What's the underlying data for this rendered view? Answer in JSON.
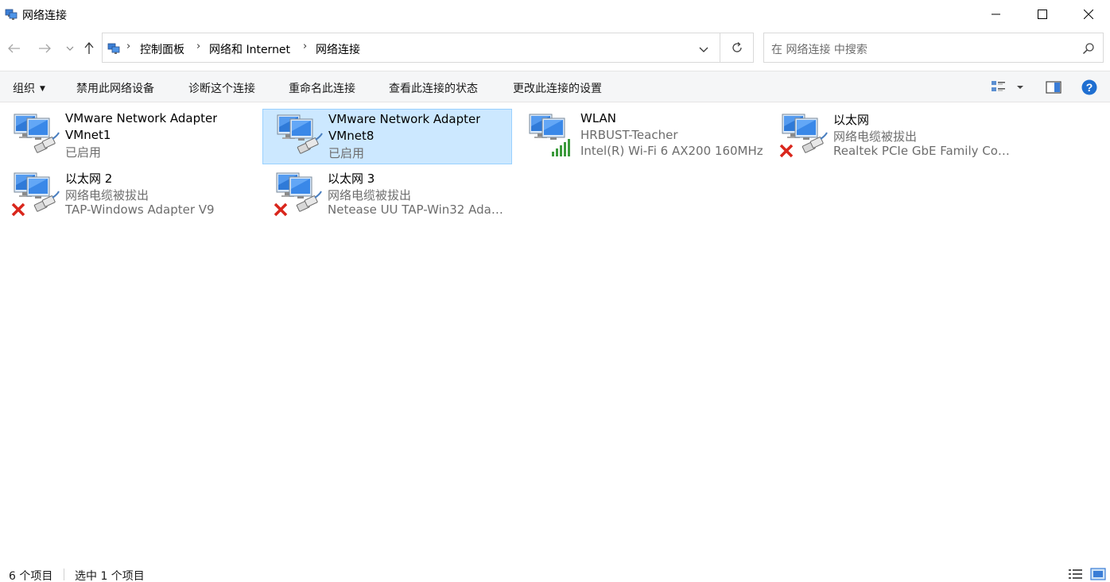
{
  "window": {
    "title": "网络连接",
    "controls": [
      "minimize-icon",
      "maximize-icon",
      "close-icon"
    ]
  },
  "nav": {
    "back_icon": "arrow-left-icon",
    "forward_icon": "arrow-right-icon",
    "recent_icon": "chevron-down-icon",
    "up_icon": "arrow-up-icon"
  },
  "address": {
    "breadcrumbs": [
      "控制面板",
      "网络和 Internet",
      "网络连接"
    ],
    "search_placeholder": "在 网络连接 中搜索"
  },
  "toolbar": {
    "organize_label": "组织",
    "commands": [
      "禁用此网络设备",
      "诊断这个连接",
      "重命名此连接",
      "查看此连接的状态",
      "更改此连接的设置"
    ]
  },
  "connections": [
    {
      "name": "VMware Network Adapter",
      "name2": "VMnet1",
      "status": "已启用",
      "device": "",
      "state": "enabled",
      "selected": false
    },
    {
      "name": "VMware Network Adapter",
      "name2": "VMnet8",
      "status": "已启用",
      "device": "",
      "state": "enabled",
      "selected": true
    },
    {
      "name": "WLAN",
      "name2": "",
      "status": "HRBUST-Teacher",
      "device": "Intel(R) Wi-Fi 6 AX200 160MHz",
      "state": "wifi",
      "selected": false
    },
    {
      "name": "以太网",
      "name2": "",
      "status": "网络电缆被拔出",
      "device": "Realtek PCIe GbE Family Contr...",
      "state": "disconnected",
      "selected": false
    },
    {
      "name": "以太网 2",
      "name2": "",
      "status": "网络电缆被拔出",
      "device": "TAP-Windows Adapter V9",
      "state": "disconnected",
      "selected": false
    },
    {
      "name": "以太网 3",
      "name2": "",
      "status": "网络电缆被拔出",
      "device": "Netease UU TAP-Win32 Adapt...",
      "state": "disconnected",
      "selected": false
    }
  ],
  "status": {
    "item_count": "6 个项目",
    "selection": "选中 1 个项目"
  },
  "colors": {
    "selection_bg": "#cce8ff",
    "selection_border": "#99d1ff",
    "help_blue": "#1f6fd1",
    "error_red": "#d9261c",
    "signal_green": "#3b9a3b"
  }
}
